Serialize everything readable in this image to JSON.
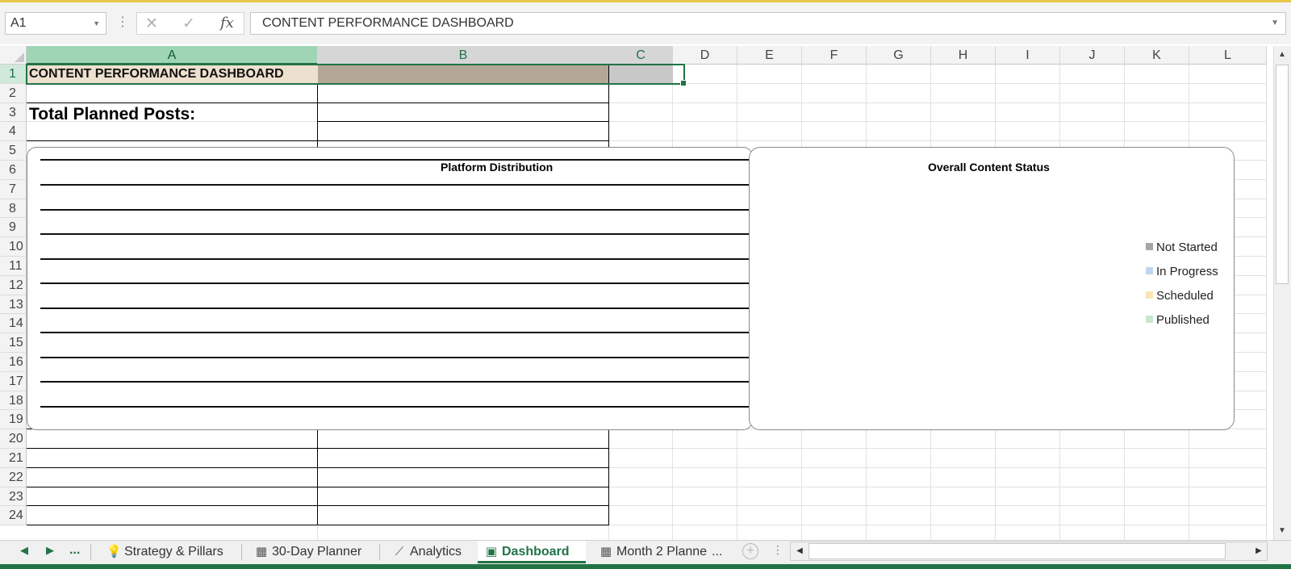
{
  "formula_bar": {
    "name_box": "A1",
    "fx_label": "fx",
    "content": "CONTENT PERFORMANCE DASHBOARD"
  },
  "columns": [
    "A",
    "B",
    "C",
    "D",
    "E",
    "F",
    "G",
    "H",
    "I",
    "J",
    "K",
    "L"
  ],
  "rows": [
    "1",
    "2",
    "3",
    "4",
    "5",
    "6",
    "7",
    "8",
    "9",
    "10",
    "11",
    "12",
    "13",
    "14",
    "15",
    "16",
    "17",
    "18",
    "19",
    "20",
    "21",
    "22",
    "23",
    "24"
  ],
  "cells": {
    "a1": "CONTENT PERFORMANCE DASHBOARD",
    "a3": "Total Planned Posts:"
  },
  "charts": {
    "platform_title": "Platform Distribution",
    "status_title": "Overall Content Status",
    "status_legend": [
      {
        "label": "Not Started",
        "color": "#a6a6a6"
      },
      {
        "label": "In Progress",
        "color": "#bdd7ee"
      },
      {
        "label": "Scheduled",
        "color": "#fce4b4"
      },
      {
        "label": "Published",
        "color": "#c6e8cf"
      }
    ]
  },
  "sheet_tabs": [
    {
      "label": "Strategy & Pillars",
      "icon": "lightbulb-icon",
      "active": false
    },
    {
      "label": "30-Day Planner",
      "icon": "calendar-icon",
      "active": false
    },
    {
      "label": "Analytics",
      "icon": "line-chart-icon",
      "active": false
    },
    {
      "label": "Dashboard",
      "icon": "dashboard-icon",
      "active": true
    },
    {
      "label": "Month 2 Planne",
      "icon": "calendar-icon",
      "active": false
    }
  ],
  "tab_nav": {
    "more": "...",
    "tab_more": "..."
  },
  "colors": {
    "accent": "#217346",
    "a1_fill": "#ede0ce",
    "b1_fill": "#b4a797",
    "c1_fill": "#c8c8c8"
  }
}
